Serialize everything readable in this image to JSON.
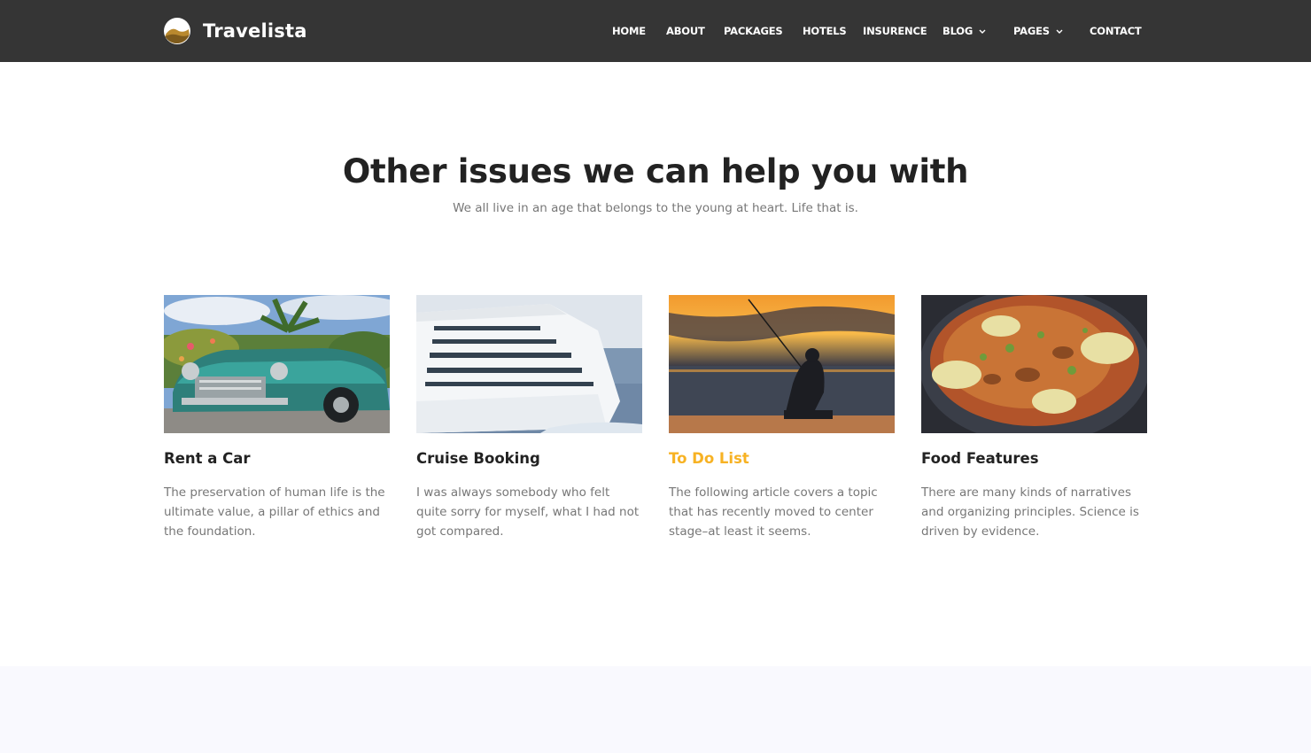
{
  "brand": {
    "name": "Travelista",
    "icon": "sunset-hill-logo-icon"
  },
  "nav": {
    "items": [
      {
        "label": "HOME",
        "has_dropdown": false
      },
      {
        "label": "ABOUT",
        "has_dropdown": false
      },
      {
        "label": "PACKAGES",
        "has_dropdown": false
      },
      {
        "label": "HOTELS",
        "has_dropdown": false
      },
      {
        "label": "INSURENCE",
        "has_dropdown": false
      },
      {
        "label": "BLOG",
        "has_dropdown": true
      },
      {
        "label": "PAGES",
        "has_dropdown": true
      },
      {
        "label": "CONTACT",
        "has_dropdown": false
      }
    ]
  },
  "section": {
    "title": "Other issues we can help you with",
    "subtitle": "We all live in an age that belongs to the young at heart. Life that is."
  },
  "cards": [
    {
      "title": "Rent a Car",
      "text": "The preservation of human life is the ultimate value, a pillar of ethics and the foundation.",
      "image": "vintage-car-photo",
      "highlighted": false
    },
    {
      "title": "Cruise Booking",
      "text": "I was always somebody who felt quite sorry for myself, what I had not got compared.",
      "image": "cruise-ship-photo",
      "highlighted": false
    },
    {
      "title": "To Do List",
      "text": "The following article covers a topic that has recently moved to center stage–at least it seems.",
      "image": "sunset-fishing-photo",
      "highlighted": true
    },
    {
      "title": "Food Features",
      "text": "There are many kinds of narratives and organizing principles. Science is driven by evidence.",
      "image": "noodle-dish-photo",
      "highlighted": false
    }
  ],
  "colors": {
    "nav_bg": "#353535",
    "accent": "#f7b223",
    "heading": "#222222",
    "body_text": "#777777",
    "footer_band": "#f9f9fe"
  }
}
